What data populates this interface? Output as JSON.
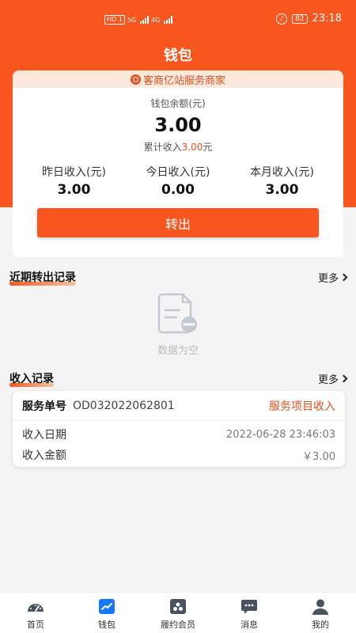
{
  "status_bar": {
    "network_badge": "HD 1",
    "network_types": [
      "5G",
      "4G"
    ],
    "battery": "82",
    "time": "23:18"
  },
  "page": {
    "title": "钱包"
  },
  "wallet": {
    "merchant_name": "客商亿站服务商家",
    "balance_label": "钱包余额(元)",
    "balance": "3.00",
    "cumulative_prefix": "累计收入",
    "cumulative_value": "3.00",
    "cumulative_suffix": "元",
    "stats": [
      {
        "label": "昨日收入(元)",
        "value": "3.00"
      },
      {
        "label": "今日收入(元)",
        "value": "0.00"
      },
      {
        "label": "本月收入(元)",
        "value": "3.00"
      }
    ],
    "withdraw_label": "转出"
  },
  "recent_withdrawals": {
    "title": "近期转出记录",
    "more_label": "更多",
    "empty_text": "数据为空"
  },
  "income_records": {
    "title": "收入记录",
    "more_label": "更多",
    "items": [
      {
        "order_label": "服务单号",
        "order_no": "OD032022062801",
        "type": "服务项目收入",
        "date_label": "收入日期",
        "date": "2022-06-28 23:46:03",
        "amount_label": "收入金额",
        "amount": "￥3.00"
      }
    ]
  },
  "bottom_nav": [
    {
      "label": "首页",
      "icon": "dashboard-icon"
    },
    {
      "label": "钱包",
      "icon": "chart-icon",
      "active": true
    },
    {
      "label": "履约会员",
      "icon": "members-icon"
    },
    {
      "label": "消息",
      "icon": "message-icon"
    },
    {
      "label": "我的",
      "icon": "person-icon"
    }
  ],
  "colors": {
    "accent": "#f7561e",
    "active_nav": "#1677ff"
  }
}
